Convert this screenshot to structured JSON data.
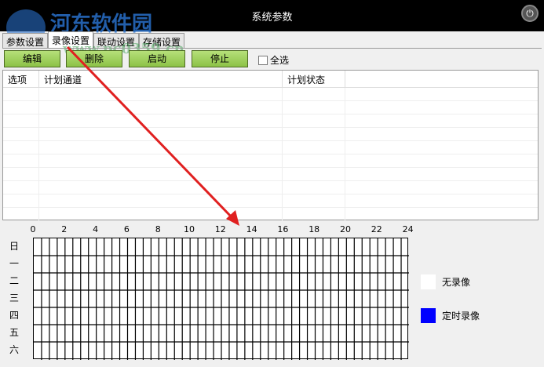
{
  "window": {
    "title": "系统参数",
    "close_icon": "power-icon"
  },
  "watermark": {
    "name": "河东软件园",
    "url": "www.pc0359.cn"
  },
  "tabs": [
    {
      "label": "参数设置"
    },
    {
      "label": "录像设置",
      "active": true
    },
    {
      "label": "联动设置"
    },
    {
      "label": "存储设置"
    }
  ],
  "toolbar": {
    "edit": "编辑",
    "delete": "删除",
    "start": "启动",
    "stop": "停止",
    "select_all": "全选"
  },
  "table": {
    "columns": [
      "选项",
      "计划通道",
      "计划状态"
    ],
    "rows": []
  },
  "schedule": {
    "hours": [
      "0",
      "2",
      "4",
      "6",
      "8",
      "10",
      "12",
      "14",
      "16",
      "18",
      "20",
      "22",
      "24"
    ],
    "days": [
      "日",
      "一",
      "二",
      "三",
      "四",
      "五",
      "六"
    ]
  },
  "legend": [
    {
      "label": "无录像",
      "color": "#ffffff"
    },
    {
      "label": "定时录像",
      "color": "#0000ff"
    }
  ]
}
